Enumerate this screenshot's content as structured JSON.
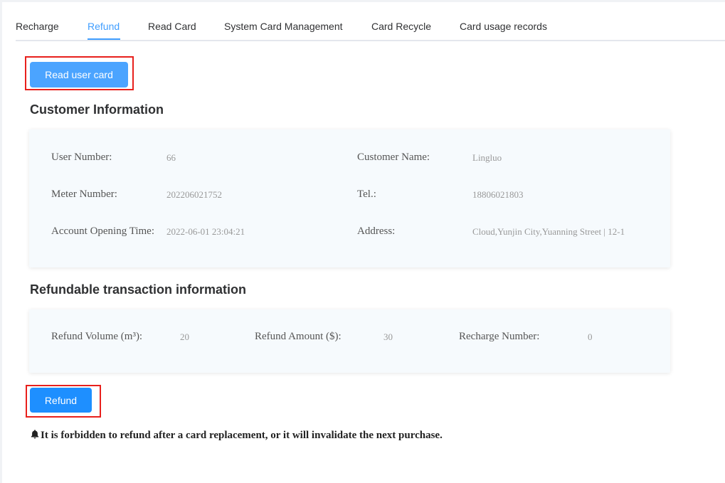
{
  "tabs": [
    {
      "label": "Recharge",
      "active": false
    },
    {
      "label": "Refund",
      "active": true
    },
    {
      "label": "Read Card",
      "active": false
    },
    {
      "label": "System Card Management",
      "active": false
    },
    {
      "label": "Card Recycle",
      "active": false
    },
    {
      "label": "Card usage records",
      "active": false
    }
  ],
  "buttons": {
    "read_card": "Read user card",
    "refund": "Refund"
  },
  "customer": {
    "title": "Customer Information",
    "fields": {
      "user_number": {
        "label": "User Number:",
        "value": "66"
      },
      "customer_name": {
        "label": "Customer Name:",
        "value": "Lingluo"
      },
      "meter_number": {
        "label": "Meter Number:",
        "value": "202206021752"
      },
      "tel": {
        "label": "Tel.:",
        "value": "18806021803"
      },
      "opening_time": {
        "label": "Account Opening Time:",
        "value": "2022-06-01 23:04:21"
      },
      "address": {
        "label": "Address:",
        "value": "Cloud,Yunjin City,Yuanning Street | 12-1"
      }
    }
  },
  "refundable": {
    "title": "Refundable transaction information",
    "fields": {
      "volume": {
        "label": "Refund Volume (m³):",
        "value": "20"
      },
      "amount": {
        "label": "Refund Amount ($):",
        "value": "30"
      },
      "recharge_number": {
        "label": "Recharge Number:",
        "value": "0"
      }
    }
  },
  "notice": "It is forbidden to refund after a card replacement, or it will invalidate the next purchase.",
  "colors": {
    "accent": "#409eff",
    "highlight": "#e8201c"
  },
  "icons": {
    "notice": "bell-icon"
  }
}
